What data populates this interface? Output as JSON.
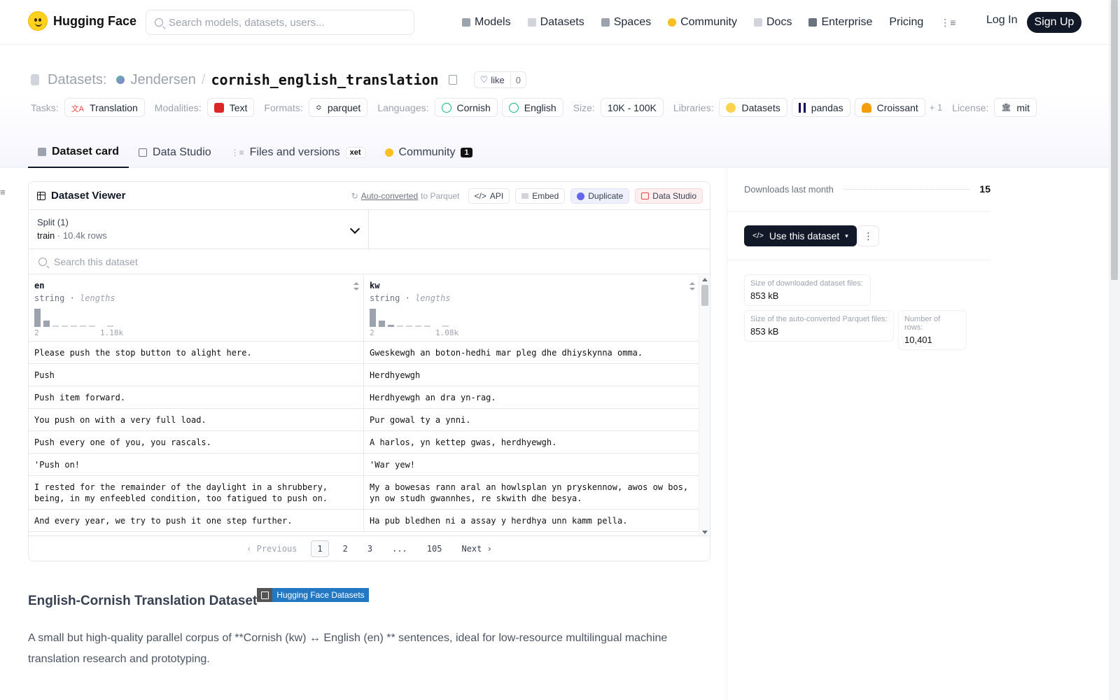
{
  "brand": {
    "name": "Hugging Face"
  },
  "search": {
    "placeholder": "Search models, datasets, users..."
  },
  "nav": {
    "items": [
      {
        "label": "Models",
        "color": "#9ca3af"
      },
      {
        "label": "Datasets",
        "color": "#d1d5db"
      },
      {
        "label": "Spaces",
        "color": "#9ca3af"
      },
      {
        "label": "Community",
        "color": "#fbbf24"
      },
      {
        "label": "Docs",
        "color": "#d1d5db"
      },
      {
        "label": "Enterprise",
        "color": "#6b7280"
      },
      {
        "label": "Pricing",
        "color": ""
      }
    ],
    "login": "Log In",
    "signup": "Sign Up"
  },
  "header": {
    "section": "Datasets:",
    "user": "Jendersen",
    "sep": "/",
    "name": "cornish_english_translation",
    "like_label": "like",
    "like_count": "0"
  },
  "tags": {
    "tasks_label": "Tasks:",
    "task": "Translation",
    "modalities_label": "Modalities:",
    "modality": "Text",
    "formats_label": "Formats:",
    "format": "parquet",
    "languages_label": "Languages:",
    "lang1": "Cornish",
    "lang2": "English",
    "size_label": "Size:",
    "size": "10K - 100K",
    "libraries_label": "Libraries:",
    "lib1": "Datasets",
    "lib2": "pandas",
    "lib3": "Croissant",
    "more": "+ 1",
    "license_label": "License:",
    "license": "mit"
  },
  "tabs": {
    "card": "Dataset card",
    "studio": "Data Studio",
    "files": "Files and versions",
    "xet": "xet",
    "community": "Community",
    "community_count": "1"
  },
  "viewer": {
    "title": "Dataset Viewer",
    "auto_link": "Auto-converted",
    "auto_rest": "to Parquet",
    "api": "API",
    "embed": "Embed",
    "duplicate": "Duplicate",
    "studio": "Data Studio",
    "split_label": "Split (1)",
    "split_name": "train",
    "split_dot": "·",
    "split_rows": "10.4k rows",
    "search_placeholder": "Search this dataset",
    "columns": [
      {
        "name": "en",
        "type": "string",
        "sep": "·",
        "stat": "lengths",
        "min": "2",
        "max": "1.18k",
        "bins": [
          1.0,
          0.35,
          0.06,
          0.06,
          0.06,
          0.06,
          0.06,
          0,
          0.06
        ]
      },
      {
        "name": "kw",
        "type": "string",
        "sep": "·",
        "stat": "lengths",
        "min": "2",
        "max": "1.08k",
        "bins": [
          1.0,
          0.35,
          0.12,
          0.06,
          0.06,
          0.06,
          0.06,
          0,
          0.06
        ]
      }
    ],
    "rows": [
      {
        "en": "Please push the stop button to alight here.",
        "kw": "Gweskewgh an boton-hedhi mar pleg dhe dhiyskynna omma."
      },
      {
        "en": "Push",
        "kw": "Herdhyewgh"
      },
      {
        "en": "Push item forward.",
        "kw": "Herdhyewgh an dra yn-rag."
      },
      {
        "en": "You push on with a very full load.",
        "kw": "Pur gowal ty a ynni."
      },
      {
        "en": "Push every one of you, you rascals.",
        "kw": "A harlos, yn kettep gwas, herdhyewgh."
      },
      {
        "en": "'Push on!",
        "kw": "'War yew!"
      },
      {
        "en": "I rested for the remainder of the daylight in a shrubbery, being, in my enfeebled condition, too fatigued to push on.",
        "kw": "My a bowesas rann aral an howlsplan yn pryskennow, awos ow bos, yn ow studh gwannhes, re skwith dhe besya."
      },
      {
        "en": "And every year, we try to push it one step further.",
        "kw": "Ha pub bledhen ni a assay y herdhya unn kamm pella."
      }
    ],
    "pager": {
      "prev": "Previous",
      "p1": "1",
      "p2": "2",
      "p3": "3",
      "ellipsis": "...",
      "last": "105",
      "next": "Next"
    }
  },
  "card": {
    "heading": "English-Cornish Translation Dataset",
    "badge": "Hugging Face Datasets",
    "paragraph": "A small but high-quality parallel corpus of **Cornish (kw) ↔ English (en) ** sentences, ideal for low-resource multilingual machine translation research and prototyping."
  },
  "sidebar": {
    "downloads_label": "Downloads last month",
    "downloads": "15",
    "use_button": "Use this dataset",
    "stats": [
      {
        "label": "Size of downloaded dataset files:",
        "value": "853 kB"
      },
      {
        "label": "Size of the auto-converted Parquet files:",
        "value": "853 kB"
      },
      {
        "label": "Number of rows:",
        "value": "10,401"
      }
    ]
  }
}
